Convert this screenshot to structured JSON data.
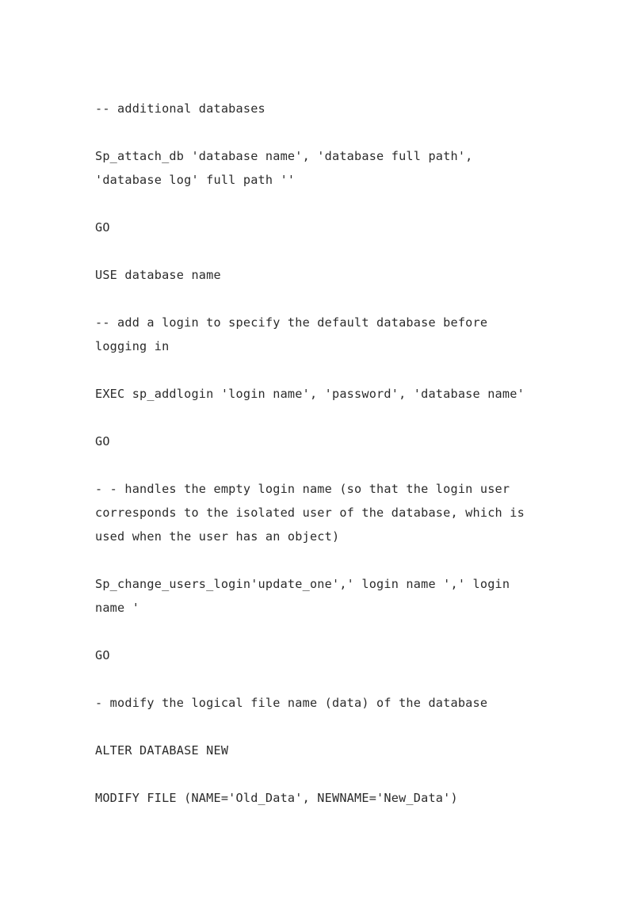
{
  "document": {
    "page_background": "#ffffff",
    "text_color": "#2b2b2b",
    "paragraphs": [
      {
        "id": "comment-additional-databases",
        "text": "-- additional databases"
      },
      {
        "id": "sp-attach-db",
        "text": "Sp_attach_db 'database name', 'database full path', 'database log' full path ''"
      },
      {
        "id": "go-1",
        "text": "GO"
      },
      {
        "id": "use-database",
        "text": "USE database name"
      },
      {
        "id": "comment-add-login",
        "text": "-- add a login to specify the default database before logging in"
      },
      {
        "id": "exec-sp-addlogin",
        "text": "EXEC sp_addlogin 'login name', 'password', 'database name'"
      },
      {
        "id": "go-2",
        "text": "GO"
      },
      {
        "id": "comment-handles-empty-login",
        "text": "- - handles the empty login name (so that the login user corresponds to the isolated user of the database, which is used when the user has an object)"
      },
      {
        "id": "sp-change-users-login",
        "text": "Sp_change_users_login'update_one',' login name ',' login name '"
      },
      {
        "id": "go-3",
        "text": "GO"
      },
      {
        "id": "comment-modify-logical-name",
        "text": "- modify the logical file name (data) of the database"
      },
      {
        "id": "alter-database",
        "text": "ALTER DATABASE NEW"
      },
      {
        "id": "modify-file",
        "text": "MODIFY FILE (NAME='Old_Data', NEWNAME='New_Data')"
      }
    ]
  }
}
